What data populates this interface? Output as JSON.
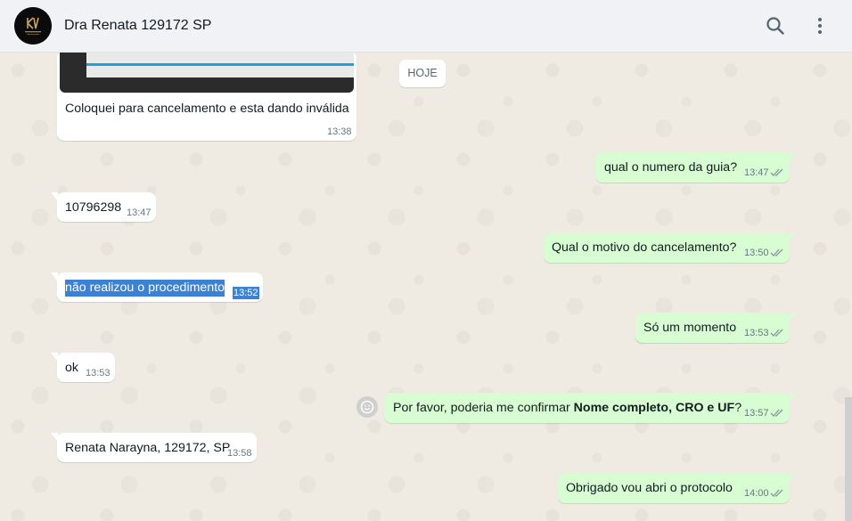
{
  "header": {
    "contact_name": "Dra Renata 129172 SP",
    "icons": [
      "search-icon",
      "menu-icon"
    ]
  },
  "day_chip": "HOJE",
  "messages": [
    {
      "direction": "in",
      "text": "Coloquei para cancelamento e esta dando inválida",
      "time": "13:38",
      "has_image": true
    },
    {
      "direction": "out",
      "text": "qual o numero da guia?",
      "time": "13:47",
      "status": "read"
    },
    {
      "direction": "in",
      "text": "10796298",
      "time": "13:47"
    },
    {
      "direction": "out",
      "text": "Qual o motivo do cancelamento?",
      "time": "13:50",
      "status": "read"
    },
    {
      "direction": "in",
      "text": "não realizou o procedimento",
      "time": "13:52",
      "selected": true
    },
    {
      "direction": "out",
      "text": "Só um momento",
      "time": "13:53",
      "status": "read"
    },
    {
      "direction": "in",
      "text": "ok",
      "time": "13:53"
    },
    {
      "direction": "out",
      "text_before": "Por favor, poderia me confirmar ",
      "text_bold": "Nome completo, CRO e UF",
      "text_after": "?",
      "time": "13:57",
      "status": "read"
    },
    {
      "direction": "in",
      "text": "Renata Narayna, 129172, SP",
      "time": "13:58"
    },
    {
      "direction": "out",
      "text": "Obrigado vou abri o protocolo",
      "time": "14:00",
      "status": "read"
    }
  ],
  "colors": {
    "header_bg": "#f0f2f5",
    "chat_bg": "#efeae2",
    "incoming_bubble": "#ffffff",
    "outgoing_bubble": "#d9fdd3",
    "selection": "#3b82d6",
    "read_ticks": "#8696a0"
  }
}
